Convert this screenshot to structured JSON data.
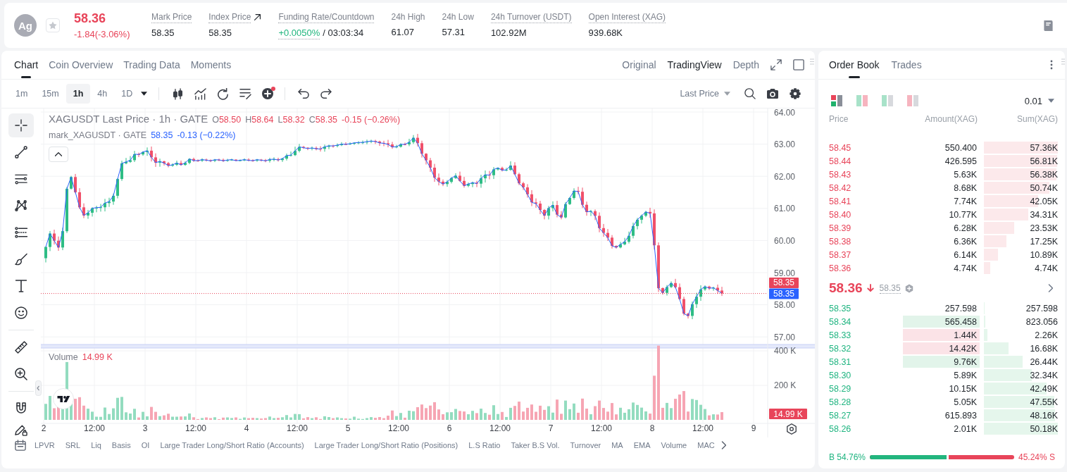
{
  "header": {
    "coin": "Ag",
    "favorite": false,
    "price": "58.36",
    "change": "-1.84(-3.06%)",
    "rising": false,
    "stats": [
      {
        "kind": "plain",
        "label": "Mark Price",
        "underlined": true,
        "value": "58.35"
      },
      {
        "kind": "link",
        "label": "Index Price",
        "underlined": true,
        "value": "58.35"
      },
      {
        "kind": "funding",
        "label": "Funding Rate/Countdown",
        "underlined": true,
        "value": "+0.0050%",
        "positive": true,
        "countdown": "/ 03:03:34"
      },
      {
        "kind": "plain",
        "label": "24h High",
        "underlined": false,
        "value": "61.07"
      },
      {
        "kind": "plain",
        "label": "24h Low",
        "underlined": false,
        "value": "57.31"
      },
      {
        "kind": "plain",
        "label": "24h Turnover (USDT)",
        "underlined": true,
        "value": "102.92M"
      },
      {
        "kind": "plain",
        "label": "Open Interest (XAG)",
        "underlined": true,
        "value": "939.68K"
      }
    ]
  },
  "chart_panel": {
    "tabs": [
      {
        "label": "Chart",
        "selected": true
      },
      {
        "label": "Coin Overview",
        "selected": false
      },
      {
        "label": "Trading Data",
        "selected": false
      },
      {
        "label": "Moments",
        "selected": false
      }
    ],
    "views": [
      {
        "label": "Original",
        "selected": false
      },
      {
        "label": "TradingView",
        "selected": true
      },
      {
        "label": "Depth",
        "selected": false
      }
    ],
    "intervals": [
      {
        "label": "1m",
        "selected": false
      },
      {
        "label": "15m",
        "selected": false
      },
      {
        "label": "1h",
        "selected": true
      },
      {
        "label": "4h",
        "selected": false
      },
      {
        "label": "1D",
        "selected": false
      }
    ],
    "chart_tools": [
      {
        "kind": "candles",
        "notification": false
      },
      {
        "kind": "indicators",
        "notification": false
      },
      {
        "kind": "replay",
        "notification": false
      },
      {
        "kind": "templates",
        "notification": false
      },
      {
        "kind": "add",
        "notification": true
      }
    ],
    "price_source": "Last Price",
    "drawing_tool_groups": [
      {
        "tools": [
          {
            "kind": "crosshair",
            "selected": true
          },
          {
            "kind": "trend-line",
            "selected": false
          },
          {
            "kind": "horizontal-lines",
            "selected": false
          },
          {
            "kind": "pattern",
            "selected": false
          },
          {
            "kind": "dotted-lines",
            "selected": false
          },
          {
            "kind": "brush",
            "selected": false
          },
          {
            "kind": "text",
            "selected": false
          },
          {
            "kind": "emoji",
            "selected": false
          }
        ]
      },
      {
        "tools": [
          {
            "kind": "ruler",
            "selected": false
          },
          {
            "kind": "zoom",
            "selected": false
          }
        ]
      },
      {
        "tools": [
          {
            "kind": "magnet",
            "selected": false
          },
          {
            "kind": "lock",
            "selected": false
          }
        ]
      }
    ],
    "legend": {
      "title": "XAGUSDT Last Price · 1h · GATE",
      "rising": false,
      "ohlc": [
        {
          "label": "O",
          "value": "58.50"
        },
        {
          "label": "H",
          "value": "58.64"
        },
        {
          "label": "L",
          "value": "58.32"
        },
        {
          "label": "C",
          "value": "58.35"
        }
      ],
      "change": "-0.15 (−0.26%)",
      "mark_title": "mark_XAGUSDT · GATE",
      "mark_value": "58.35",
      "mark_change": "-0.13 (−0.22%)"
    },
    "price_axis": [
      "64.00",
      "63.00",
      "62.00",
      "61.00",
      "60.00",
      "59.00",
      "58.00",
      "57.00"
    ],
    "last_price_tag": "58.35",
    "mark_price_tag": "58.35",
    "volume": {
      "title": "Volume",
      "value": "14.99 K",
      "rising": false,
      "axis": [
        "400 K",
        "200 K"
      ],
      "tag": "14.99 K"
    },
    "time_axis": [
      "2",
      "12:00",
      "3",
      "12:00",
      "4",
      "12:00",
      "5",
      "12:00",
      "6",
      "12:00",
      "7",
      "12:00",
      "8",
      "12:00",
      "9"
    ],
    "indicators": [
      "LPVR",
      "SRL",
      "Liq",
      "Basis",
      "OI",
      "Large Trader Long/Short Ratio (Accounts)",
      "Large Trader Long/Short Ratio (Positions)",
      "L.S Ratio",
      "Taker B.S Vol.",
      "Turnover",
      "MA",
      "EMA",
      "Volume",
      "MAC"
    ]
  },
  "order_book": {
    "tabs": [
      {
        "label": "Order Book",
        "selected": true
      },
      {
        "label": "Trades",
        "selected": false
      }
    ],
    "view_modes": [
      {
        "kind": "both",
        "selected": true
      },
      {
        "kind": "split",
        "selected": false
      },
      {
        "kind": "bids",
        "selected": false
      },
      {
        "kind": "asks",
        "selected": false
      }
    ],
    "precision": "0.01",
    "columns": [
      "Price",
      "Amount(XAG)",
      "Sum(XAG)"
    ],
    "asks": [
      {
        "price": "58.45",
        "amount": "550.400",
        "sum": "57.36K",
        "level": 1.0
      },
      {
        "price": "58.44",
        "amount": "426.595",
        "sum": "56.81K",
        "level": 0.99
      },
      {
        "price": "58.43",
        "amount": "5.63K",
        "sum": "56.38K",
        "level": 0.983
      },
      {
        "price": "58.42",
        "amount": "8.68K",
        "sum": "50.74K",
        "level": 0.885
      },
      {
        "price": "58.41",
        "amount": "7.74K",
        "sum": "42.05K",
        "level": 0.733
      },
      {
        "price": "58.40",
        "amount": "10.77K",
        "sum": "34.31K",
        "level": 0.598
      },
      {
        "price": "58.39",
        "amount": "6.28K",
        "sum": "23.53K",
        "level": 0.41
      },
      {
        "price": "58.38",
        "amount": "6.36K",
        "sum": "17.25K",
        "level": 0.3
      },
      {
        "price": "58.37",
        "amount": "6.14K",
        "sum": "10.89K",
        "level": 0.19
      },
      {
        "price": "58.36",
        "amount": "4.74K",
        "sum": "4.74K",
        "level": 0.083
      }
    ],
    "last_price": "58.36",
    "rising": false,
    "mark_price": "58.35",
    "bids": [
      {
        "price": "58.35",
        "amount": "257.598",
        "sum": "257.598",
        "level": 0.005,
        "increased": false,
        "decreased": false
      },
      {
        "price": "58.34",
        "amount": "565.458",
        "sum": "823.056",
        "level": 0.016,
        "increased": true,
        "decreased": false
      },
      {
        "price": "58.33",
        "amount": "1.44K",
        "sum": "2.26K",
        "level": 0.045,
        "increased": false,
        "decreased": true
      },
      {
        "price": "58.32",
        "amount": "14.42K",
        "sum": "16.68K",
        "level": 0.332,
        "increased": false,
        "decreased": true
      },
      {
        "price": "58.31",
        "amount": "9.76K",
        "sum": "26.44K",
        "level": 0.527,
        "increased": true,
        "decreased": false
      },
      {
        "price": "58.30",
        "amount": "5.89K",
        "sum": "32.34K",
        "level": 0.644,
        "increased": false,
        "decreased": false
      },
      {
        "price": "58.29",
        "amount": "10.15K",
        "sum": "42.49K",
        "level": 0.847,
        "increased": false,
        "decreased": false
      },
      {
        "price": "58.28",
        "amount": "5.05K",
        "sum": "47.55K",
        "level": 0.948,
        "increased": false,
        "decreased": false
      },
      {
        "price": "58.27",
        "amount": "615.893",
        "sum": "48.16K",
        "level": 0.96,
        "increased": false,
        "decreased": false
      },
      {
        "price": "58.26",
        "amount": "2.01K",
        "sum": "50.18K",
        "level": 1.0,
        "increased": false,
        "decreased": false
      }
    ],
    "ratio": {
      "buy": "B 54.76%",
      "sell": "45.24% S",
      "level": 0.5476
    }
  }
}
